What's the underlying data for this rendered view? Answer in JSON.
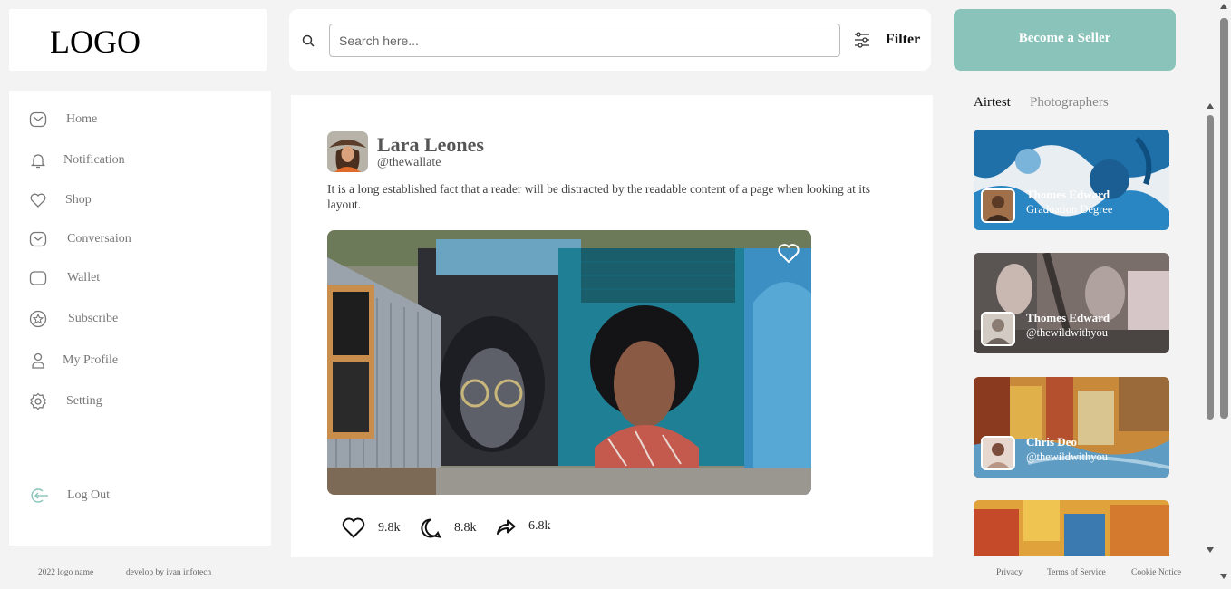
{
  "logo": "LOGO",
  "search": {
    "placeholder": "Search here...",
    "filter_label": "Filter"
  },
  "seller_button": "Become a Seller",
  "sidebar": {
    "items": [
      {
        "label": "Home",
        "icon": "home-icon"
      },
      {
        "label": "Notification",
        "icon": "bell-icon"
      },
      {
        "label": "Shop",
        "icon": "heart-icon"
      },
      {
        "label": "Conversaion",
        "icon": "chat-icon"
      },
      {
        "label": "Wallet",
        "icon": "wallet-icon"
      },
      {
        "label": "Subscribe",
        "icon": "star-icon"
      },
      {
        "label": "My Profile",
        "icon": "user-icon"
      },
      {
        "label": "Setting",
        "icon": "gear-icon"
      }
    ],
    "logout": "Log Out"
  },
  "post": {
    "author": "Lara Leones",
    "handle": "@thewallate",
    "text": "It is a long established fact that a reader will be distracted by the readable content of a page when looking at its layout.",
    "likes": "9.8k",
    "comments": "8.8k",
    "shares": "6.8k"
  },
  "right": {
    "tabs": [
      "Airtest",
      "Photographers"
    ],
    "cards": [
      {
        "name": "Thomes Edward",
        "sub": "Graduation Degree"
      },
      {
        "name": "Thomes Edward",
        "sub": "@thewildwithyou"
      },
      {
        "name": "Chris Deo",
        "sub": "@thewildwithyou"
      },
      {
        "name": "",
        "sub": ""
      }
    ]
  },
  "footer": {
    "copyright": "2022 logo name",
    "developer": "develop by ivan infotech",
    "links": [
      "Privacy",
      "Terms of Service",
      "Cookie Notice"
    ]
  },
  "colors": {
    "accent": "#8ac3b9",
    "background": "#f3f3f3"
  }
}
